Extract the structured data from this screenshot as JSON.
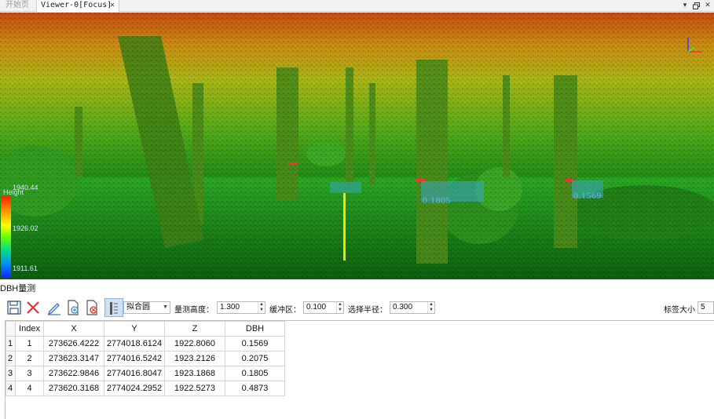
{
  "tabs": {
    "start_tab": "开始页",
    "viewer_tab": "Viewer-0[Focus]",
    "close_glyph": "✕"
  },
  "window_controls": {
    "dropdown": "▾",
    "restore": "🗗",
    "close": "✕"
  },
  "legend": {
    "title": "Height",
    "max": "1940.44",
    "mid": "1926.02",
    "min": "1911.61"
  },
  "markers": [
    {
      "label": "0.1805"
    },
    {
      "label": "0.1569"
    }
  ],
  "panel": {
    "title": "DBH量测",
    "toolbar": {
      "save_icon": "save-icon",
      "delete_icon": "delete-icon",
      "edit_icon": "edit-icon",
      "export_icon": "export-icon",
      "clear_icon": "clear-icon",
      "mode_icon": "fit-mode-icon",
      "fit_method": "拟合圆",
      "height_label": "量测高度：",
      "height_value": "1.300",
      "buffer_label": "缓冲区：",
      "buffer_value": "0.100",
      "radius_label": "选择半径：",
      "radius_value": "0.300",
      "tag_size_label": "标签大小",
      "tag_size_value": "5"
    },
    "table": {
      "headers": [
        "Index",
        "X",
        "Y",
        "Z",
        "DBH"
      ],
      "rows": [
        {
          "num": "1",
          "index": "1",
          "x": "273626.4222",
          "y": "2774018.6124",
          "z": "1922.8060",
          "dbh": "0.1569"
        },
        {
          "num": "2",
          "index": "2",
          "x": "273623.3147",
          "y": "2774016.5242",
          "z": "1923.2126",
          "dbh": "0.2075"
        },
        {
          "num": "3",
          "index": "3",
          "x": "273622.9846",
          "y": "2774016.8047",
          "z": "1923.1868",
          "dbh": "0.1805"
        },
        {
          "num": "4",
          "index": "4",
          "x": "273620.3168",
          "y": "2774024.2952",
          "z": "1922.5273",
          "dbh": "0.4873"
        }
      ]
    }
  }
}
